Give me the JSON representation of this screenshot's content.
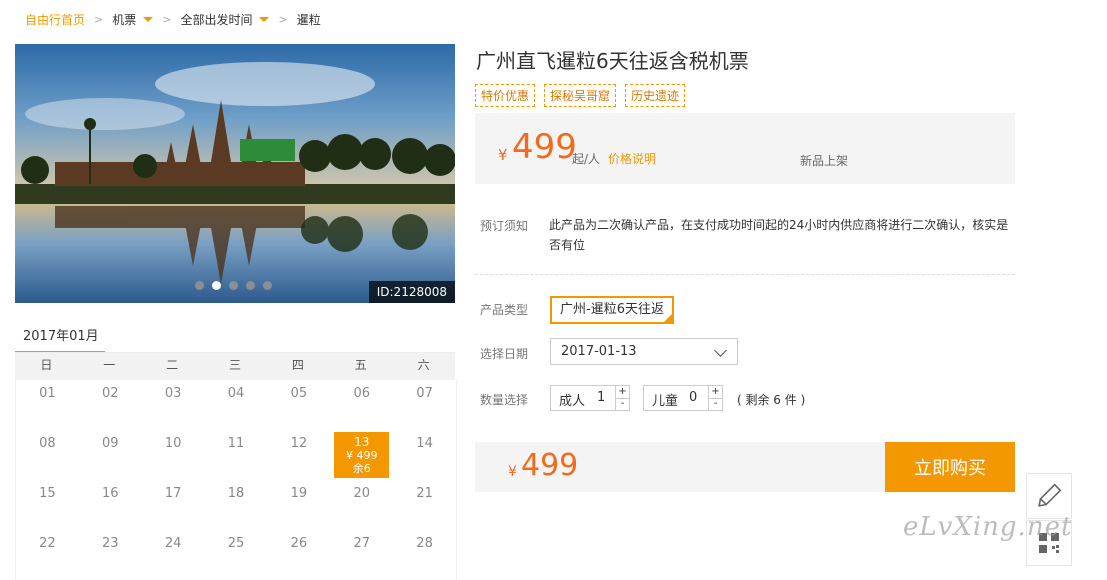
{
  "breadcrumb": {
    "home": "自由行首页",
    "items": [
      "机票",
      "全部出发时间",
      "暹粒"
    ],
    "separator": ">"
  },
  "hero": {
    "id_label": "ID:2128008",
    "slide_count": 5,
    "active_slide": 2
  },
  "calendar": {
    "month": "2017年01月",
    "weekdays": [
      "日",
      "一",
      "二",
      "三",
      "四",
      "五",
      "六"
    ],
    "days": [
      "01",
      "02",
      "03",
      "04",
      "05",
      "06",
      "07",
      "08",
      "09",
      "10",
      "11",
      "12",
      "13",
      "14",
      "15",
      "16",
      "17",
      "18",
      "19",
      "20",
      "21",
      "22",
      "23",
      "24",
      "25",
      "26",
      "27",
      "28"
    ],
    "selected": {
      "day": "13",
      "price": "¥ 499",
      "remain": "余6"
    }
  },
  "product": {
    "title": "广州直飞暹粒6天往返含税机票",
    "tags": [
      "特价优惠",
      "探秘吴哥窟",
      "历史遗迹"
    ],
    "price_currency": "¥",
    "price": "499",
    "price_unit": "起/人",
    "price_link": "价格说明",
    "status": "新品上架",
    "notice_label": "预订须知",
    "notice": "此产品为二次确认产品，在支付成功时间起的24小时内供应商将进行二次确认，核实是否有位",
    "type_label": "产品类型",
    "type_value": "广州-暹粒6天往返",
    "date_label": "选择日期",
    "date_value": "2017-01-13",
    "qty_label": "数量选择",
    "adult_label": "成人",
    "adult_count": "1",
    "child_label": "儿童",
    "child_count": "0",
    "plus": "+",
    "minus": "-",
    "remain": "( 剩余 6 件 )",
    "total_currency": "¥",
    "total": "499",
    "buy_label": "立即购买"
  },
  "watermark": "eLvXing.net",
  "colors": {
    "accent": "#f39800",
    "price": "#f26b1d"
  },
  "icons": {
    "edit": "pencil-icon",
    "qr": "qrcode-icon"
  }
}
